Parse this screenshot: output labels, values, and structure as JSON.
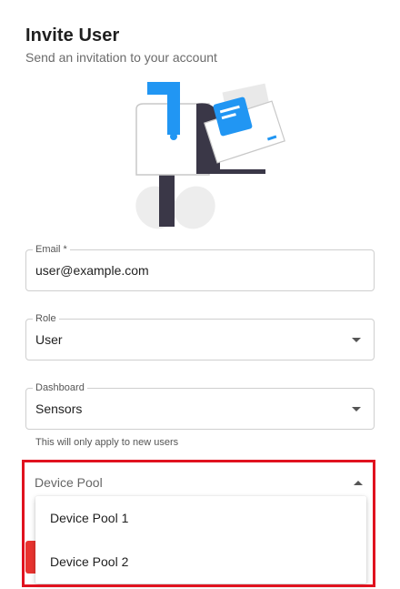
{
  "header": {
    "title": "Invite User",
    "subtitle": "Send an invitation to your account"
  },
  "illustration": {
    "icon": "mailbox-illustration",
    "colors": {
      "blue": "#2196f3",
      "dark": "#3a3747",
      "gray": "#e9e9e9"
    }
  },
  "form": {
    "email": {
      "label": "Email *",
      "value": "user@example.com"
    },
    "role": {
      "label": "Role",
      "value": "User"
    },
    "dashboard": {
      "label": "Dashboard",
      "value": "Sensors",
      "helper": "This will only apply to new users"
    },
    "device_pool": {
      "label": "Device Pool",
      "options": [
        "Device Pool 1",
        "Device Pool 2"
      ]
    }
  },
  "colors": {
    "highlight": "#e0121f",
    "primary_button": "#e8332f"
  }
}
